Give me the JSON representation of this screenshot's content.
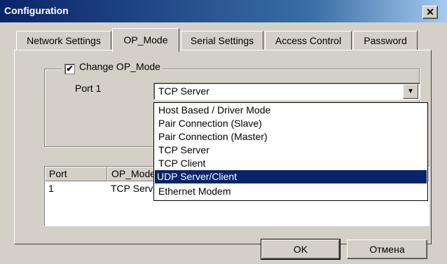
{
  "window": {
    "title": "Configuration",
    "close_glyph": "✕"
  },
  "tabs": [
    {
      "label": "Network Settings",
      "active": false
    },
    {
      "label": "OP_Mode",
      "active": true
    },
    {
      "label": "Serial Settings",
      "active": false
    },
    {
      "label": "Access Control",
      "active": false
    },
    {
      "label": "Password",
      "active": false
    }
  ],
  "group": {
    "checkbox_label": "Change OP_Mode",
    "checked": true,
    "check_glyph": "✔"
  },
  "port": {
    "label": "Port 1",
    "selected_value": "TCP Server",
    "dropdown_arrow": "▼"
  },
  "dropdown_options": [
    "Host Based / Driver Mode",
    "Pair Connection (Slave)",
    "Pair Connection (Master)",
    "TCP Server",
    "TCP Client",
    "UDP Server/Client",
    "Ethernet Modem"
  ],
  "highlighted_option": "UDP Server/Client",
  "listview": {
    "columns": [
      "Port",
      "OP_Mode"
    ],
    "rows": [
      [
        "1",
        "TCP Server"
      ]
    ]
  },
  "buttons": {
    "ok": "OK",
    "cancel": "Отмена"
  },
  "colors": {
    "titlebar": "#0a246a",
    "face": "#d4d0c8",
    "highlight": "#0a246a"
  }
}
